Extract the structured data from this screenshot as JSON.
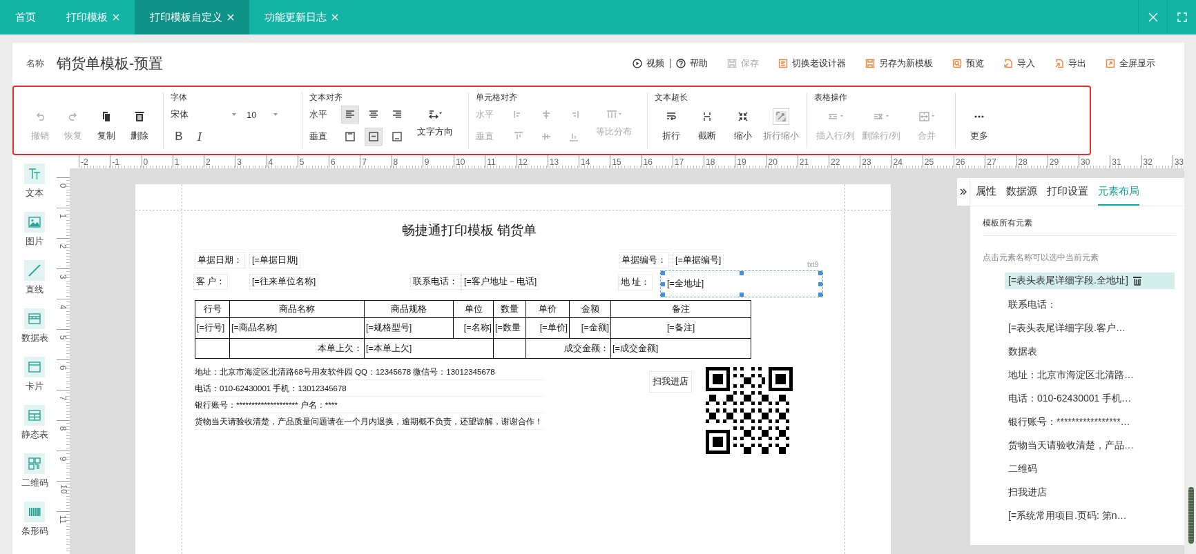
{
  "top_tabs": [
    {
      "label": "首页",
      "closable": false,
      "selected": false
    },
    {
      "label": "打印模板",
      "closable": true,
      "selected": false
    },
    {
      "label": "打印模板自定义",
      "closable": true,
      "selected": true
    },
    {
      "label": "功能更新日志",
      "closable": true,
      "selected": false
    }
  ],
  "template": {
    "name_label": "名称",
    "name": "销货单模板-预置"
  },
  "actions": [
    {
      "label": "视频",
      "disabled": false
    },
    {
      "label": "帮助",
      "disabled": false
    },
    {
      "label": "保存",
      "disabled": true
    },
    {
      "label": "切换老设计器",
      "disabled": false
    },
    {
      "label": "另存为新模板",
      "disabled": false
    },
    {
      "label": "预览",
      "disabled": false
    },
    {
      "label": "导入",
      "disabled": false
    },
    {
      "label": "导出",
      "disabled": false
    },
    {
      "label": "全屏显示",
      "disabled": false
    }
  ],
  "toolbar": {
    "edit": [
      {
        "label": "撤销",
        "disabled": true
      },
      {
        "label": "恢复",
        "disabled": true
      },
      {
        "label": "复制",
        "disabled": false
      },
      {
        "label": "删除",
        "disabled": false
      }
    ],
    "font": {
      "title": "字体",
      "family": "宋体",
      "size": "10",
      "styles": [
        "B",
        "I"
      ]
    },
    "text_align": {
      "title": "文本对齐",
      "horizontal_label": "水平",
      "vertical_label": "垂直",
      "horizontal": [
        {
          "selected": true
        },
        {
          "selected": false
        },
        {
          "selected": false
        }
      ],
      "vertical": [
        {
          "selected": false
        },
        {
          "selected": true
        },
        {
          "selected": false
        }
      ],
      "direction_label": "文字方向"
    },
    "cell_align": {
      "title": "单元格对齐",
      "horizontal_label": "水平",
      "vertical_label": "垂直",
      "disabled": true,
      "distribute_label": "等比分布"
    },
    "overflow": {
      "title": "文本超长",
      "items": [
        {
          "label": "折行",
          "selected": false
        },
        {
          "label": "截断",
          "selected": false
        },
        {
          "label": "缩小",
          "selected": false
        },
        {
          "label": "折行缩小",
          "selected": true
        }
      ]
    },
    "table_ops": {
      "title": "表格操作",
      "items": [
        {
          "label": "插入行/列",
          "disabled": true
        },
        {
          "label": "删除行/列",
          "disabled": true
        },
        {
          "label": "合并",
          "disabled": true
        }
      ]
    },
    "more": {
      "label": "更多"
    }
  },
  "ruler": {
    "horizontal": [
      "-2",
      "-1",
      "0",
      "1",
      "2",
      "3",
      "4",
      "5",
      "6",
      "7",
      "8",
      "9",
      "10",
      "11",
      "12",
      "13",
      "14",
      "15",
      "16",
      "17",
      "18",
      "19",
      "20",
      "21",
      "22",
      "23",
      "24",
      "25",
      "26",
      "27",
      "28",
      "29",
      "30",
      "31",
      "32",
      "33"
    ],
    "vertical": [
      "0",
      "1",
      "2",
      "3",
      "4",
      "5",
      "6",
      "7",
      "8",
      "9",
      "10",
      "11"
    ]
  },
  "tools": [
    "文本",
    "图片",
    "直线",
    "数据表",
    "卡片",
    "静态表",
    "二维码",
    "条形码"
  ],
  "document": {
    "title": "畅捷通打印模板 销货单",
    "fields": [
      {
        "label": "单据日期：",
        "value": "[=单据日期]",
        "selected": false
      },
      {
        "label": "客 户：",
        "value": "[=往来单位名称]",
        "selected": false
      },
      {
        "label": "联系电话：",
        "value": "[=客户地址－电话]",
        "selected": false
      },
      {
        "label": "单据编号：",
        "value": "[=单据编号]",
        "selected": false
      },
      {
        "label": "地 址：",
        "value": "[=全地址]",
        "selected": true,
        "tag": "txt9"
      }
    ],
    "table": {
      "columns": [
        "行号",
        "商品名称",
        "商品规格",
        "单位",
        "数量",
        "单价",
        "金额",
        "备注"
      ],
      "row": [
        "[=行号]",
        "[=商品名称]",
        "[=规格型号]",
        "[=名称]",
        "[=数量",
        "[=单价]",
        "[=金额]",
        "[=备注]"
      ],
      "summary": [
        {
          "label": "本单上欠：",
          "value": "[=本单上欠]"
        },
        {
          "label": "成交金额：",
          "value": "[=成交金额]"
        }
      ]
    },
    "footer": [
      "地址：北京市海淀区北清路68号用友软件园 QQ：12345678 微信号：13012345678",
      "电话：010-62430001 手机：13012345678",
      "银行账号：******************** 户名：****",
      "货物当天请验收清楚，产品质量问题请在一个月内退换，逾期概不负责，还望谅解，谢谢合作！"
    ],
    "qr_caption": "扫我进店"
  },
  "side_panel": {
    "tabs": [
      {
        "label": "属性",
        "selected": false
      },
      {
        "label": "数据源",
        "selected": false
      },
      {
        "label": "打印设置",
        "selected": false
      },
      {
        "label": "元素布局",
        "selected": true
      }
    ],
    "section_title": "模板所有元素",
    "hint": "点击元素名称可以选中当前元素",
    "elements": [
      {
        "text": "[=表头表尾详细字段.全地址]",
        "selected": true
      },
      {
        "text": "联系电话：",
        "selected": false
      },
      {
        "text": "[=表头表尾详细字段.客户…",
        "selected": false
      },
      {
        "text": "数据表",
        "selected": false
      },
      {
        "text": "地址：北京市海淀区北清路…",
        "selected": false
      },
      {
        "text": "电话：010-62430001 手机…",
        "selected": false
      },
      {
        "text": "银行账号：*****************…",
        "selected": false
      },
      {
        "text": "货物当天请验收清楚，产品…",
        "selected": false
      },
      {
        "text": "二维码",
        "selected": false
      },
      {
        "text": "扫我进店",
        "selected": false
      },
      {
        "text": "[=系统常用项目.页码: 第n…",
        "selected": false
      }
    ]
  }
}
